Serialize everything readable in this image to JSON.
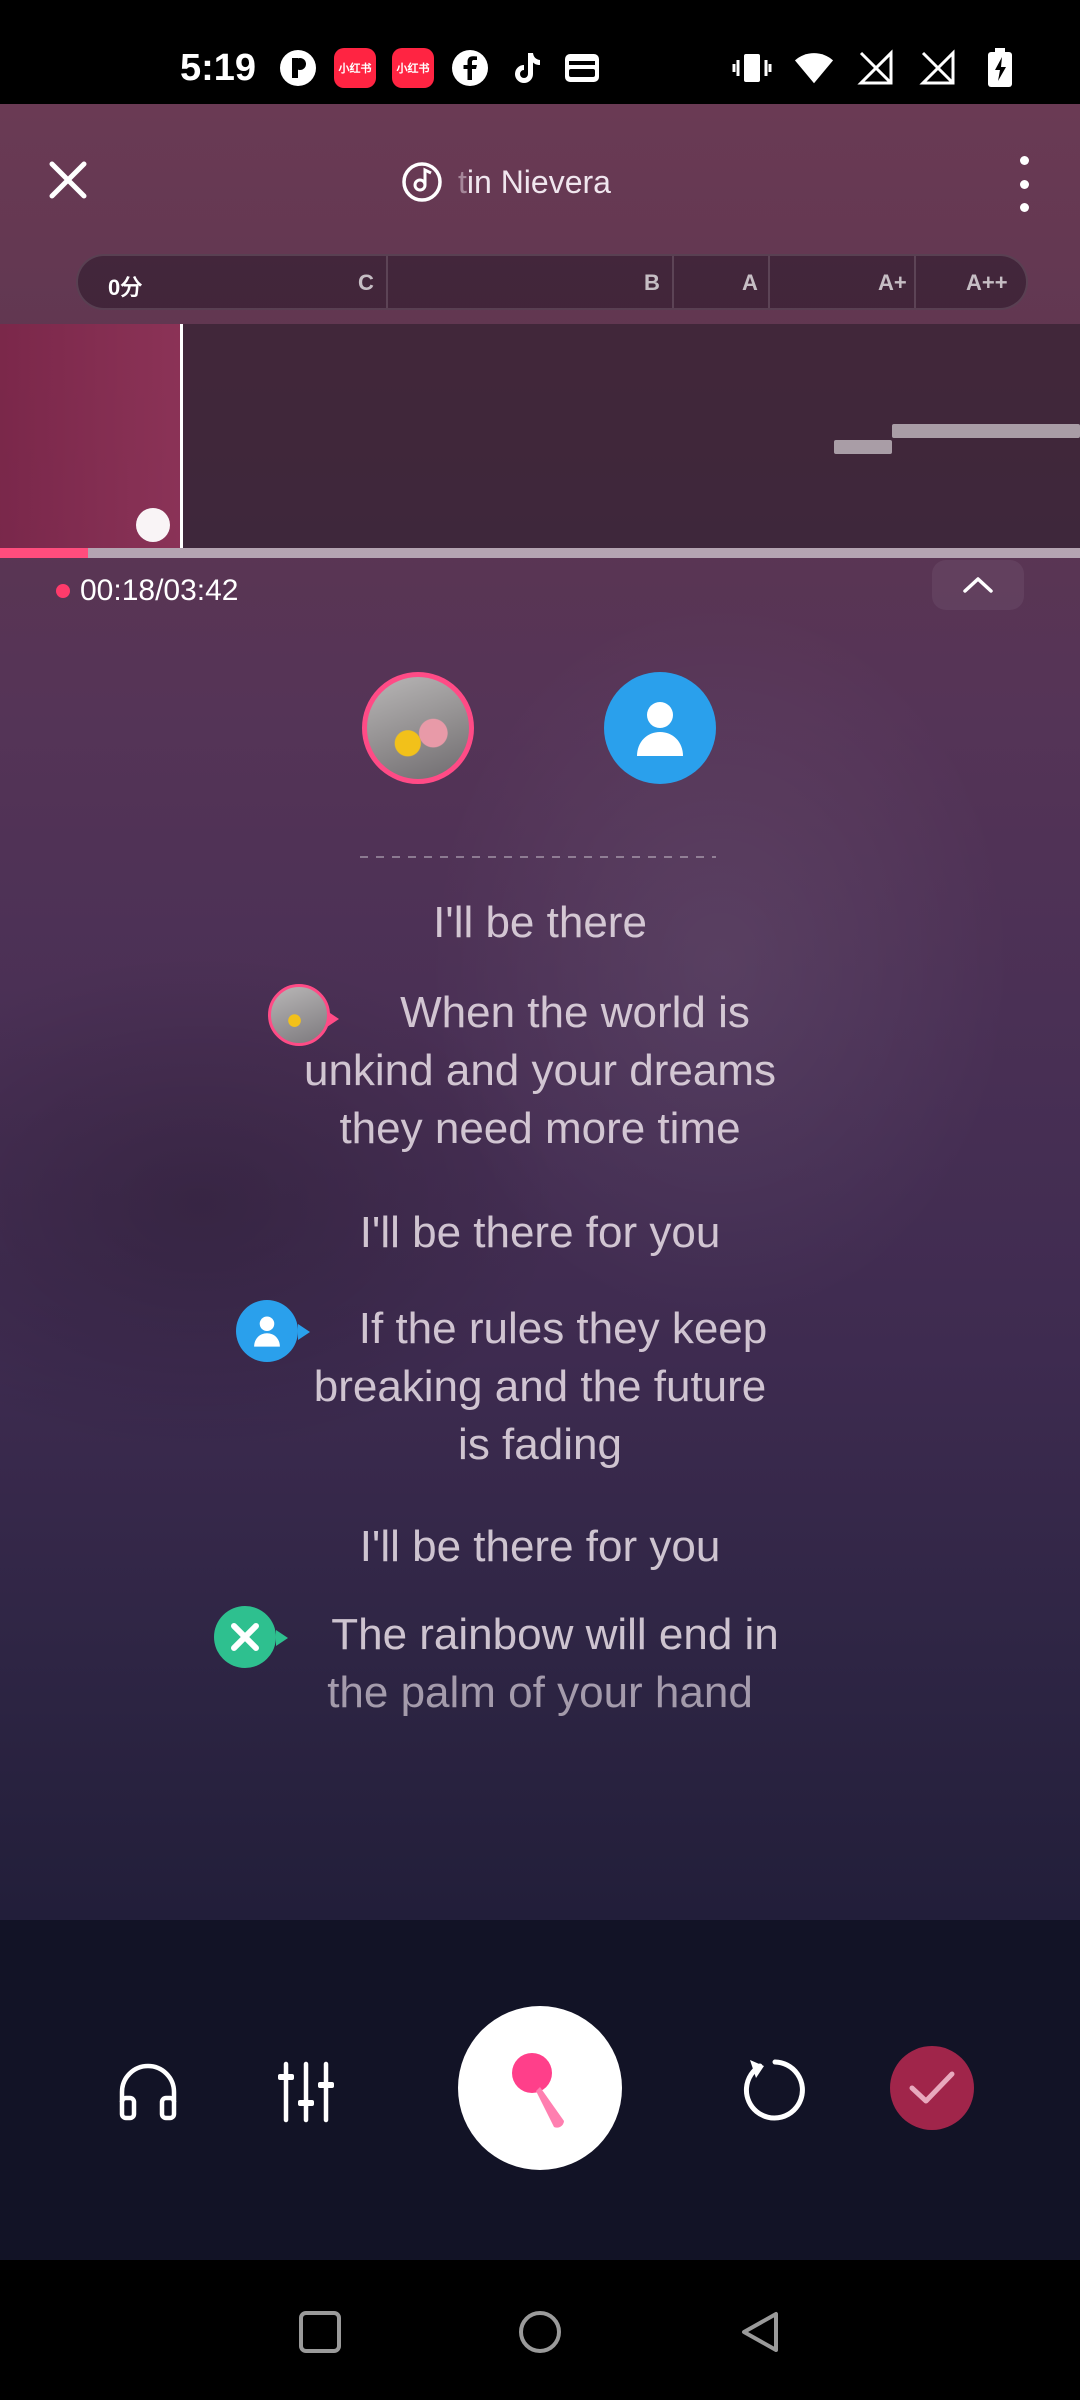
{
  "status_bar": {
    "time": "5:19",
    "left_icons": [
      "p-app-icon",
      "xiaohongshu-icon",
      "xiaohongshu-icon",
      "facebook-icon",
      "tiktok-icon",
      "wallet-icon"
    ],
    "xiaohongshu_label": "小红书",
    "right_icons": [
      "vibrate-icon",
      "wifi-icon",
      "no-signal-icon",
      "no-signal-icon",
      "battery-charging-icon"
    ]
  },
  "top_bar": {
    "song_title_faded": "t",
    "song_title": "in Nievera"
  },
  "score_bar": {
    "score": "0分",
    "grades": [
      "C",
      "B",
      "A",
      "A+",
      "A++"
    ]
  },
  "playback": {
    "time": "00:18/03:42",
    "progress_fraction": 0.0811
  },
  "singers": {
    "a": "singer-a",
    "b": "singer-b"
  },
  "lyrics": {
    "line1": "I'll be there",
    "line2a": "When the world is",
    "line2b": "unkind and your dreams",
    "line2c": "they need more time",
    "line3": "I'll be there for you",
    "line4a": "If the rules they keep",
    "line4b": "breaking and the future",
    "line4c": "is fading",
    "line5": "I'll be there for you",
    "line6a": "The rainbow will end in",
    "line6b": "the palm of your hand"
  },
  "controls": {
    "icons": [
      "headphones-icon",
      "mixer-sliders-icon",
      "microphone-icon",
      "retry-icon",
      "checkmark-icon"
    ]
  },
  "colors": {
    "accent": "#ff4b86",
    "progress": "#ff4d7d",
    "done": "#a0254a",
    "singer_b": "#2aa0ec",
    "singer_c": "#2ec08f"
  }
}
